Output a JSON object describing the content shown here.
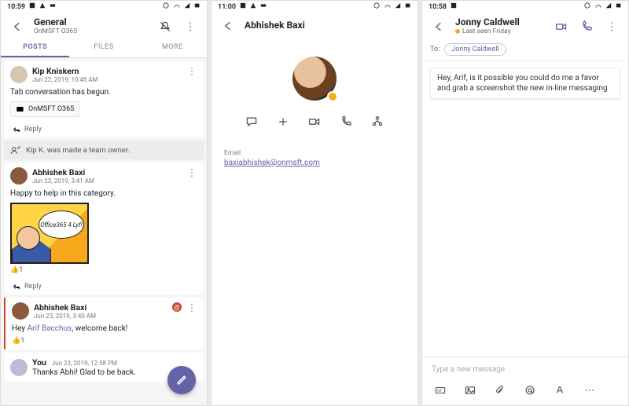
{
  "colors": {
    "accent": "#6264A7",
    "away": "#f2b01e",
    "alert": "#c8472a"
  },
  "screen1": {
    "status_time": "10:59",
    "header": {
      "title": "General",
      "subtitle": "OnMSFT O365"
    },
    "tabs": [
      "POSTS",
      "FILES",
      "MORE"
    ],
    "active_tab_index": 0,
    "posts": [
      {
        "author": "Kip Kniskern",
        "time": "Jun 22, 2019, 10:48 AM",
        "body": "Tab conversation has begun.",
        "chip": "OnMSFT O365",
        "reply_label": "Reply"
      },
      {
        "system": true,
        "text": "Kip K. was made a team owner."
      },
      {
        "author": "Abhishek Baxi",
        "time": "Jun 23, 2019, 3:41 AM",
        "body": "Happy to help in this category.",
        "sticker_text": "Office365 4 Lyf!",
        "react": "👍1",
        "reply_label": "Reply"
      },
      {
        "author": "Abhishek Baxi",
        "time": "Jun 23, 2019, 3:40 AM",
        "mention": "Arif Bacchus",
        "body_prefix": "Hey ",
        "body_suffix": ", welcome back!",
        "react": "👍1",
        "alert": "@"
      },
      {
        "author": "You",
        "time": "Jun 23, 2019, 12:58 PM",
        "body": "Thanks Abhi! Glad to be back."
      }
    ]
  },
  "screen2": {
    "status_time": "11:00",
    "header_name": "Abhishek Baxi",
    "presence": "away",
    "actions": [
      "chat",
      "add",
      "video",
      "call",
      "org"
    ],
    "email_label": "Email",
    "email_value": "baxiabhishek@onmsft.com"
  },
  "screen3": {
    "status_time": "10:58",
    "header": {
      "name": "Jonny Caldwell",
      "presence_text": "Last seen Friday"
    },
    "to_label": "To:",
    "to_pill": "Jonny Caldwell",
    "draft_text": "Hey, Arif, is it possible you could do me a favor and grab a screenshot the new in-line messaging",
    "compose_placeholder": "Type a new message",
    "compose_icons": [
      "gif",
      "image",
      "attach",
      "mention",
      "format",
      "more"
    ]
  }
}
